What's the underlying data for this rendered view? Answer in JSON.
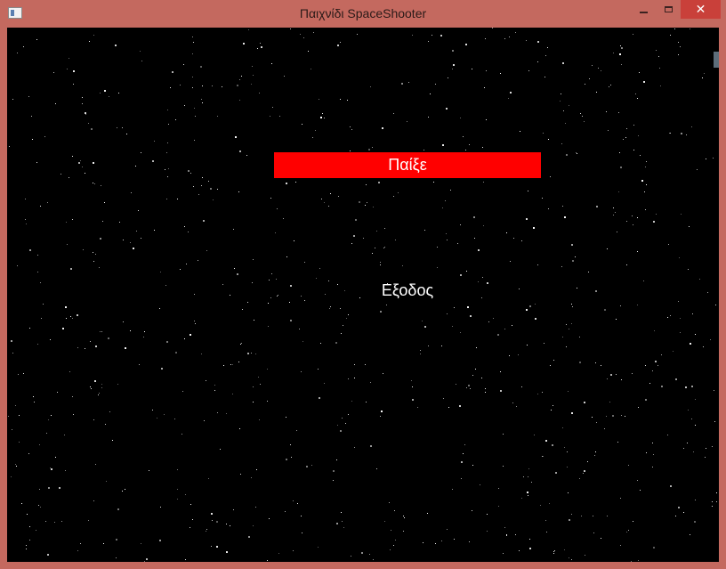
{
  "window": {
    "title": "Παιχνίδι SpaceShooter",
    "frame_color": "#c4695f",
    "close_color": "#c9403a"
  },
  "controls": {
    "minimize_icon": "minimize-icon",
    "maximize_icon": "maximize-icon",
    "close_glyph": "✕"
  },
  "menu": {
    "items": [
      {
        "label": "Παίξε",
        "selected": true
      },
      {
        "label": "Εξοδος",
        "selected": false
      }
    ],
    "highlight_color": "#ff0000",
    "text_color": "#ffffff"
  },
  "background": {
    "color": "#000000",
    "star_color": "#ffffff"
  }
}
